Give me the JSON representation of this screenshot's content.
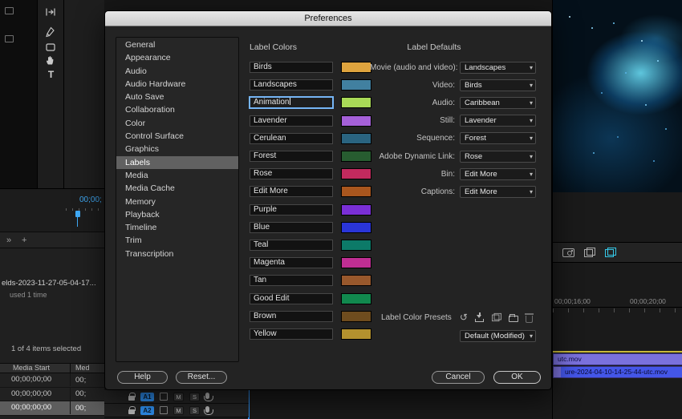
{
  "dialog": {
    "title": "Preferences",
    "sidebar": [
      {
        "label": "General"
      },
      {
        "label": "Appearance"
      },
      {
        "label": "Audio"
      },
      {
        "label": "Audio Hardware"
      },
      {
        "label": "Auto Save"
      },
      {
        "label": "Collaboration"
      },
      {
        "label": "Color"
      },
      {
        "label": "Control Surface"
      },
      {
        "label": "Graphics"
      },
      {
        "label": "Labels",
        "selected": true
      },
      {
        "label": "Media"
      },
      {
        "label": "Media Cache"
      },
      {
        "label": "Memory"
      },
      {
        "label": "Playback"
      },
      {
        "label": "Timeline"
      },
      {
        "label": "Trim"
      },
      {
        "label": "Transcription"
      }
    ],
    "label_colors": {
      "heading": "Label Colors",
      "items": [
        {
          "name": "Birds",
          "color": "#dfa43e"
        },
        {
          "name": "Landscapes",
          "color": "#4180a0"
        },
        {
          "name": "Animation",
          "color": "#a9d957",
          "editing": true
        },
        {
          "name": "Lavender",
          "color": "#a560d8"
        },
        {
          "name": "Cerulean",
          "color": "#2a6480"
        },
        {
          "name": "Forest",
          "color": "#275c30"
        },
        {
          "name": "Rose",
          "color": "#c22a5e"
        },
        {
          "name": "Edit More",
          "color": "#a9561e"
        },
        {
          "name": "Purple",
          "color": "#7a2fd6"
        },
        {
          "name": "Blue",
          "color": "#2a35d8"
        },
        {
          "name": "Teal",
          "color": "#0c7a68"
        },
        {
          "name": "Magenta",
          "color": "#bf2e93"
        },
        {
          "name": "Tan",
          "color": "#98582c"
        },
        {
          "name": "Good Edit",
          "color": "#11894e"
        },
        {
          "name": "Brown",
          "color": "#6e4c1e"
        },
        {
          "name": "Yellow",
          "color": "#b3912e"
        }
      ]
    },
    "label_defaults": {
      "heading": "Label Defaults",
      "rows": [
        {
          "label": "Movie (audio and video):",
          "value": "Landscapes"
        },
        {
          "label": "Video:",
          "value": "Birds"
        },
        {
          "label": "Audio:",
          "value": "Caribbean"
        },
        {
          "label": "Still:",
          "value": "Lavender"
        },
        {
          "label": "Sequence:",
          "value": "Forest"
        },
        {
          "label": "Adobe Dynamic Link:",
          "value": "Rose"
        },
        {
          "label": "Bin:",
          "value": "Edit More"
        },
        {
          "label": "Captions:",
          "value": "Edit More"
        }
      ]
    },
    "presets": {
      "label": "Label Color Presets",
      "value": "Default (Modified)",
      "icons": [
        "undo",
        "save-preset",
        "new-preset",
        "folder",
        "delete"
      ]
    },
    "buttons": {
      "help": "Help",
      "reset": "Reset...",
      "cancel": "Cancel",
      "ok": "OK"
    }
  },
  "app": {
    "tools": {
      "type_label": "T"
    },
    "source_monitor": {
      "timecode": "00;00;"
    },
    "panel_bottom": {
      "collapse": "»",
      "add": "+"
    },
    "project": {
      "clip_name": "elds-2023-11-27-05-04-17...",
      "usage": "used 1 time",
      "status": "1 of 4 items selected",
      "columns": [
        {
          "label": "Media Start"
        },
        {
          "label": "Med"
        }
      ],
      "rows": [
        {
          "start": "00;00;00;00",
          "extra": "00;"
        },
        {
          "start": "00;00;00;00",
          "extra": "00;"
        },
        {
          "start": "00;00;00;00",
          "extra": "00;",
          "selected": true
        }
      ]
    },
    "timeline": {
      "ruler": [
        {
          "label": "00;00;16;00"
        },
        {
          "label": "00;00;20;00"
        }
      ],
      "clips": [
        {
          "name": "utc.mov"
        },
        {
          "name": "ure-2024-04-10-14-25-44-utc.mov"
        }
      ],
      "tracks": [
        {
          "badge": "A1",
          "mute": "M",
          "solo": "S"
        },
        {
          "badge": "A2",
          "mute": "M",
          "solo": "S"
        }
      ]
    },
    "colors": {
      "accent_blue": "#2d8ceb",
      "timecode_blue": "#3fa9f5",
      "clip_violet": "#7a71dc",
      "clip_selected_blue": "#4456e8",
      "marker_yellow": "#c8b83a"
    }
  }
}
